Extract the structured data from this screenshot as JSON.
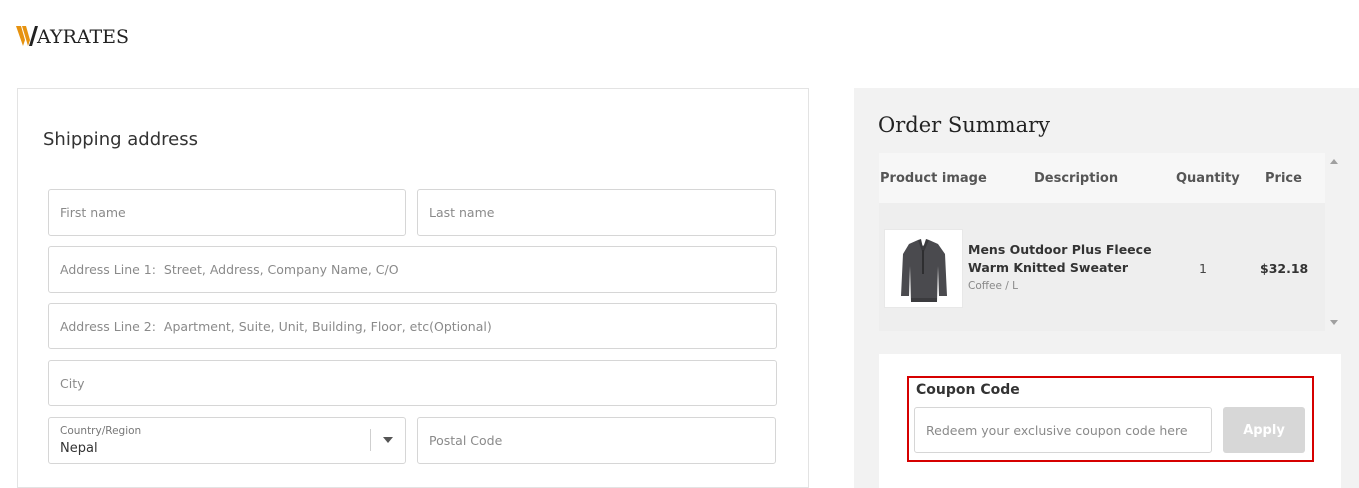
{
  "brand": {
    "name": "AYRATES",
    "accent": "#e6920f"
  },
  "shipping": {
    "title": "Shipping address",
    "first_name_placeholder": "First name",
    "last_name_placeholder": "Last name",
    "address1_placeholder": "Address Line 1:  Street, Address, Company Name, C/O",
    "address2_placeholder": "Address Line 2:  Apartment, Suite, Unit, Building, Floor, etc(Optional)",
    "city_placeholder": "City",
    "country_label": "Country/Region",
    "country_value": "Nepal",
    "postal_placeholder": "Postal Code"
  },
  "summary": {
    "title": "Order Summary",
    "columns": [
      "Product image",
      "Description",
      "Quantity",
      "Price"
    ],
    "items": [
      {
        "name": "Mens Outdoor Plus Fleece Warm Knitted Sweater",
        "variant": "Coffee / L",
        "quantity": "1",
        "price": "$32.18"
      }
    ]
  },
  "coupon": {
    "label": "Coupon Code",
    "placeholder": "Redeem your exclusive coupon code here",
    "apply_label": "Apply",
    "highlight_color": "#d60000"
  }
}
